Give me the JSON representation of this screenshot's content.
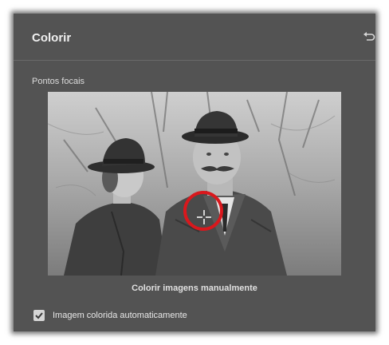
{
  "panel": {
    "title": "Colorir",
    "reset_icon": "undo-arrow-icon"
  },
  "focal_points": {
    "label": "Pontos focais",
    "photo_description_icon": "bw-photo-couple",
    "marker_icon": "crosshair-icon",
    "marker_color": "#d9181d"
  },
  "manual": {
    "label": "Colorir imagens manualmente"
  },
  "auto_color": {
    "label": "Imagem colorida automaticamente",
    "checked": true
  },
  "colors": {
    "panel_bg": "#535353",
    "accent_red": "#d9181d"
  }
}
